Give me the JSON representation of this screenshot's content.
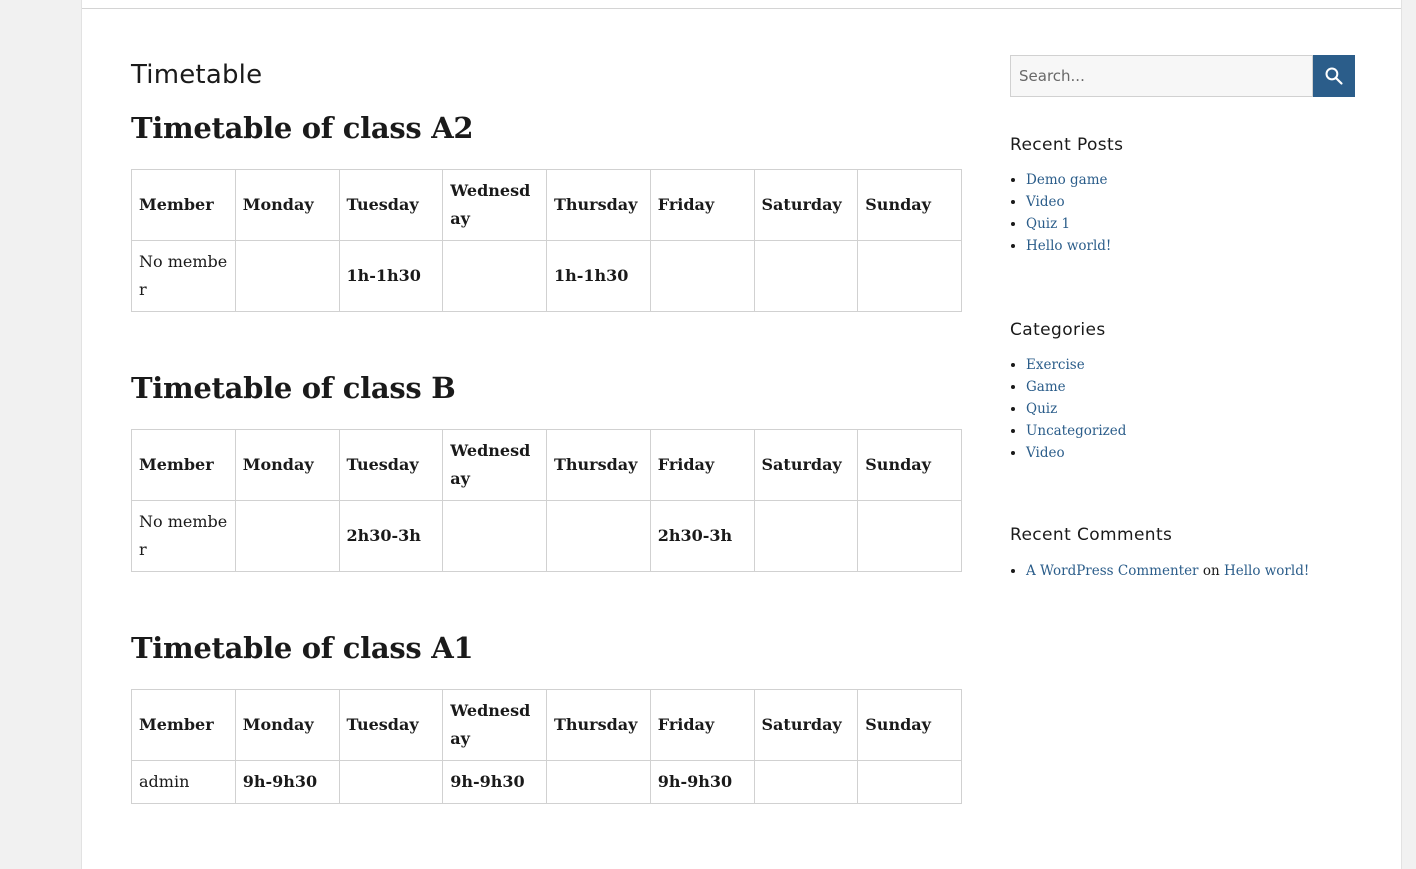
{
  "page_title": "Timetable",
  "tables": [
    {
      "heading": "Timetable of class A2",
      "headers": [
        "Member",
        "Monday",
        "Tuesday",
        "Wednesday",
        "Thursday",
        "Friday",
        "Saturday",
        "Sunday"
      ],
      "row": [
        "No member",
        "",
        "1h-1h30",
        "",
        "1h-1h30",
        "",
        "",
        ""
      ]
    },
    {
      "heading": "Timetable of class B",
      "headers": [
        "Member",
        "Monday",
        "Tuesday",
        "Wednesday",
        "Thursday",
        "Friday",
        "Saturday",
        "Sunday"
      ],
      "row": [
        "No member",
        "",
        "2h30-3h",
        "",
        "",
        "2h30-3h",
        "",
        ""
      ]
    },
    {
      "heading": "Timetable of class A1",
      "headers": [
        "Member",
        "Monday",
        "Tuesday",
        "Wednesday",
        "Thursday",
        "Friday",
        "Saturday",
        "Sunday"
      ],
      "row": [
        "admin",
        "9h-9h30",
        "",
        "9h-9h30",
        "",
        "9h-9h30",
        "",
        ""
      ]
    }
  ],
  "sidebar": {
    "search": {
      "placeholder": "Search..."
    },
    "recent_posts": {
      "title": "Recent Posts",
      "items": [
        "Demo game",
        "Video",
        "Quiz 1",
        "Hello world!"
      ]
    },
    "categories": {
      "title": "Categories",
      "items": [
        "Exercise",
        "Game",
        "Quiz",
        "Uncategorized",
        "Video"
      ]
    },
    "recent_comments": {
      "title": "Recent Comments",
      "author": "A WordPress Commenter",
      "on": "on",
      "post": "Hello world!"
    }
  },
  "colors": {
    "link": "#2b5d8a",
    "search_button": "#2b5d8a",
    "background": "#f1f1f1"
  },
  "icons": {
    "search_button": "search-icon"
  }
}
